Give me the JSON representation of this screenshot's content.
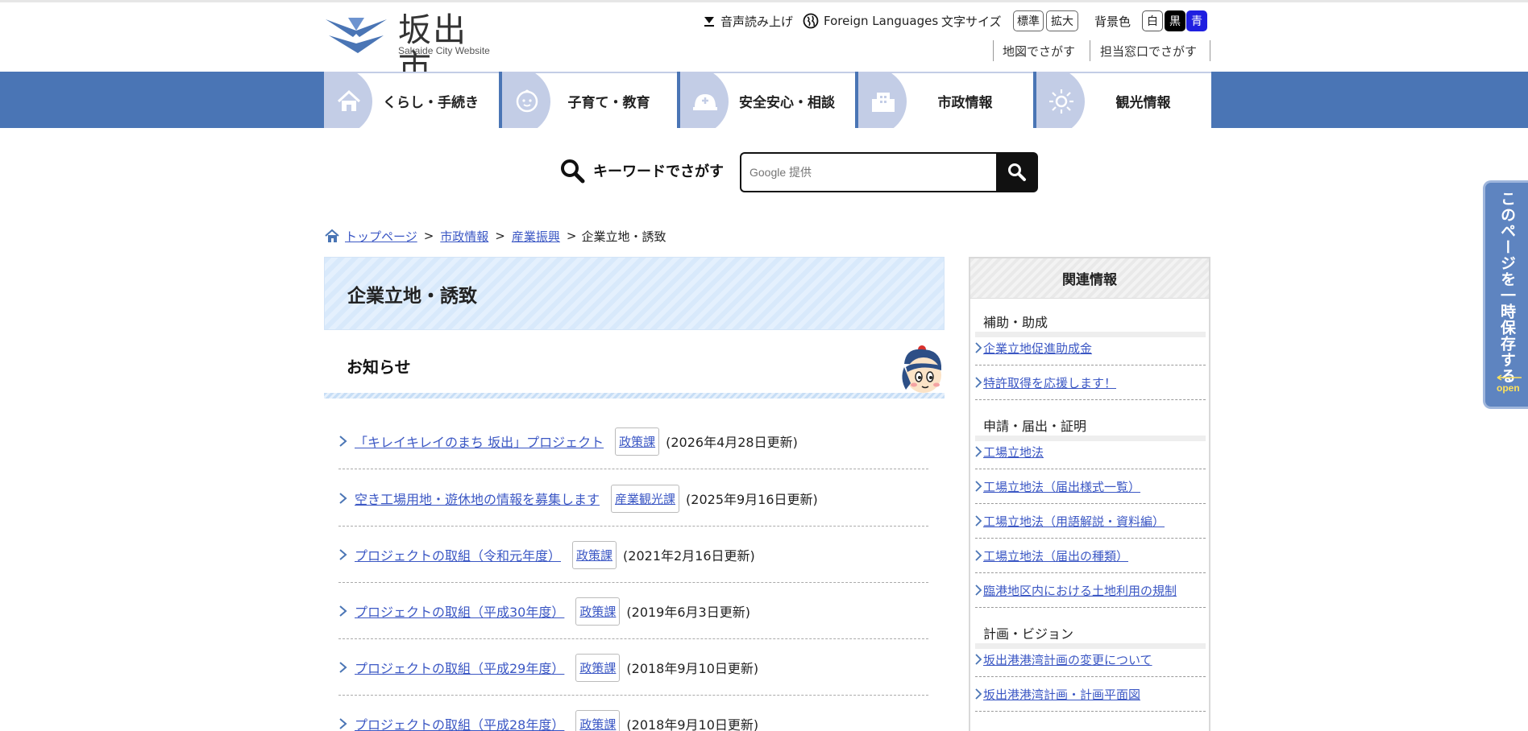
{
  "header": {
    "logo_title": "坂出市",
    "logo_subtitle": "Sakaide City Website",
    "voice_label": "音声読み上げ",
    "foreign_label": "Foreign Languages",
    "font_size_label": "文字サイズ",
    "font_standard": "標準",
    "font_large": "拡大",
    "bg_label": "背景色",
    "bg_white": "白",
    "bg_black": "黒",
    "bg_blue": "青",
    "map_search": "地図でさがす",
    "desk_search": "担当窓口でさがす"
  },
  "nav": [
    {
      "label": "くらし・手続き",
      "icon": "house-icon"
    },
    {
      "label": "子育て・教育",
      "icon": "baby-icon"
    },
    {
      "label": "安全安心・相談",
      "icon": "helmet-icon"
    },
    {
      "label": "市政情報",
      "icon": "building-icon"
    },
    {
      "label": "観光情報",
      "icon": "sun-icon"
    }
  ],
  "search": {
    "label": "キーワードでさがす",
    "placeholder": "Google 提供"
  },
  "breadcrumb": {
    "home": "トップページ",
    "level1": "市政情報",
    "level2": "産業振興",
    "current": "企業立地・誘致"
  },
  "main": {
    "title": "企業立地・誘致",
    "news_heading": "お知らせ",
    "news": [
      {
        "title": "「キレイキレイのまち 坂出」プロジェクト",
        "dept": "政策課",
        "date": "(2026年4月28日更新)"
      },
      {
        "title": "空き工場用地・遊休地の情報を募集します",
        "dept": "産業観光課",
        "date": "(2025年9月16日更新)"
      },
      {
        "title": "プロジェクトの取組（令和元年度）",
        "dept": "政策課",
        "date": "(2021年2月16日更新)"
      },
      {
        "title": "プロジェクトの取組（平成30年度）",
        "dept": "政策課",
        "date": "(2019年6月3日更新)"
      },
      {
        "title": "プロジェクトの取組（平成29年度）",
        "dept": "政策課",
        "date": "(2018年9月10日更新)"
      },
      {
        "title": "プロジェクトの取組（平成28年度）",
        "dept": "政策課",
        "date": "(2018年9月10日更新)"
      }
    ]
  },
  "sidebar": {
    "heading": "関連情報",
    "categories": [
      {
        "name": "補助・助成",
        "links": [
          "企業立地促進助成金",
          "特許取得を応援します！"
        ]
      },
      {
        "name": "申請・届出・証明",
        "links": [
          "工場立地法",
          "工場立地法（届出様式一覧）",
          "工場立地法（用語解説・資料編）",
          "工場立地法（届出の種類）",
          "臨港地区内における土地利用の規制"
        ]
      },
      {
        "name": "計画・ビジョン",
        "links": [
          "坂出港港湾計画の変更について",
          "坂出港港湾計画・計画平面図"
        ]
      }
    ]
  },
  "float_tab": {
    "text": "このページを一時保存する",
    "open": "open"
  },
  "colors": {
    "nav_blue": "#4a75b5",
    "link": "#3b57c4",
    "bg_blue_button": "#1f1fe0"
  }
}
